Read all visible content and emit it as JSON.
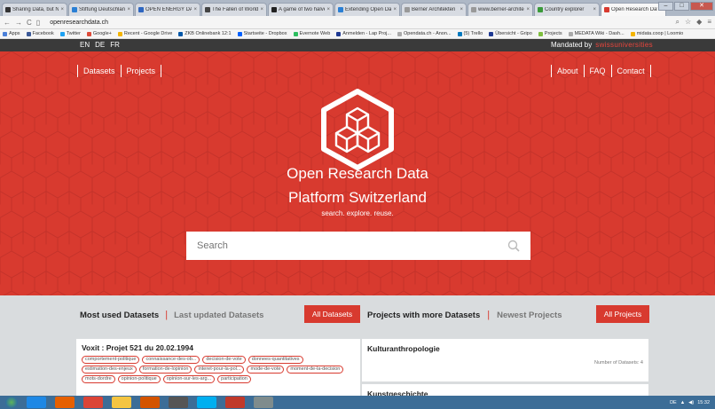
{
  "browser": {
    "tabs": [
      {
        "title": "Sharing Data, but No",
        "color": "#333333"
      },
      {
        "title": "Stiftung Deutschland",
        "color": "#2a7fd4"
      },
      {
        "title": "OPEN ENERGY DATA",
        "color": "#2e66c0"
      },
      {
        "title": "The Fallen of World W",
        "color": "#444444"
      },
      {
        "title": "A game of two halves",
        "color": "#222222"
      },
      {
        "title": "Extending Open Data",
        "color": "#2a7fd4"
      },
      {
        "title": "Berner Architekten Tr",
        "color": "#999999"
      },
      {
        "title": "www.berner-architekt",
        "color": "#999999"
      },
      {
        "title": "Country explorer",
        "color": "#3a9a3a"
      },
      {
        "title": "Open Research Data P",
        "color": "#d83a2f"
      }
    ],
    "url": "openresearchdata.ch",
    "bookmarks": [
      {
        "label": "Apps",
        "color": "#4a7fd8"
      },
      {
        "label": "Facebook",
        "color": "#3b5998"
      },
      {
        "label": "Twitter",
        "color": "#1da1f2"
      },
      {
        "label": "Google+",
        "color": "#dd4b39"
      },
      {
        "label": "Recent - Google Drive",
        "color": "#f4b400"
      },
      {
        "label": "ZKB Onlinebank 12:1",
        "color": "#0057a8"
      },
      {
        "label": "Startseite - Dropbox",
        "color": "#0061ff"
      },
      {
        "label": "Evernote Web",
        "color": "#2dbe60"
      },
      {
        "label": "Anmelden - Lap Proj...",
        "color": "#1f3a93"
      },
      {
        "label": "Opendata.ch - Anon...",
        "color": "#aaaaaa"
      },
      {
        "label": "(5) Trello",
        "color": "#0079bf"
      },
      {
        "label": "Übersicht - Gripo",
        "color": "#1f3a93"
      },
      {
        "label": "Projects",
        "color": "#7fbf3f"
      },
      {
        "label": "MEDATA Wiki - Dash...",
        "color": "#aaaaaa"
      },
      {
        "label": "midata.coop | Loomio",
        "color": "#f4b400"
      }
    ]
  },
  "site": {
    "languages": [
      "EN",
      "DE",
      "FR"
    ],
    "mandated_label": "Mandated by",
    "mandated_brand": "swissuniversities",
    "nav_left": [
      "Datasets",
      "Projects"
    ],
    "nav_right": [
      "About",
      "FAQ",
      "Contact"
    ],
    "hero_title_1": "Open Research Data",
    "hero_title_2": "Platform Switzerland",
    "tagline": "search. explore. reuse.",
    "search_placeholder": "Search",
    "accent": "#d83a2f"
  },
  "sections": {
    "ds_tab_active": "Most used Datasets",
    "ds_tab_inactive": "Last updated Datasets",
    "ds_button": "All Datasets",
    "pr_tab_active": "Projects with more Datasets",
    "pr_tab_inactive": "Newest Projects",
    "pr_button": "All Projects"
  },
  "dataset_card": {
    "title": "Voxit : Projet 521 du 20.02.1994",
    "tags": [
      "comportement-politique",
      "connaissance-des-ob...",
      "decision-de-vote",
      "donnees-quantitatives",
      "estimation-des-enjeux",
      "formation-de-lopinion",
      "interet-pour-la-pol...",
      "mode-de-vote",
      "moment-de-la-decision",
      "mots-dordre",
      "opinion-politique",
      "opinion-sur-les-arg...",
      "participation"
    ]
  },
  "project_cards": [
    {
      "title": "Kulturanthropologie",
      "count_label": "Number of Datasets: 4"
    },
    {
      "title": "Kunstgeschichte"
    }
  ],
  "taskbar": {
    "tray_text": "DE",
    "clock": "15:32"
  }
}
